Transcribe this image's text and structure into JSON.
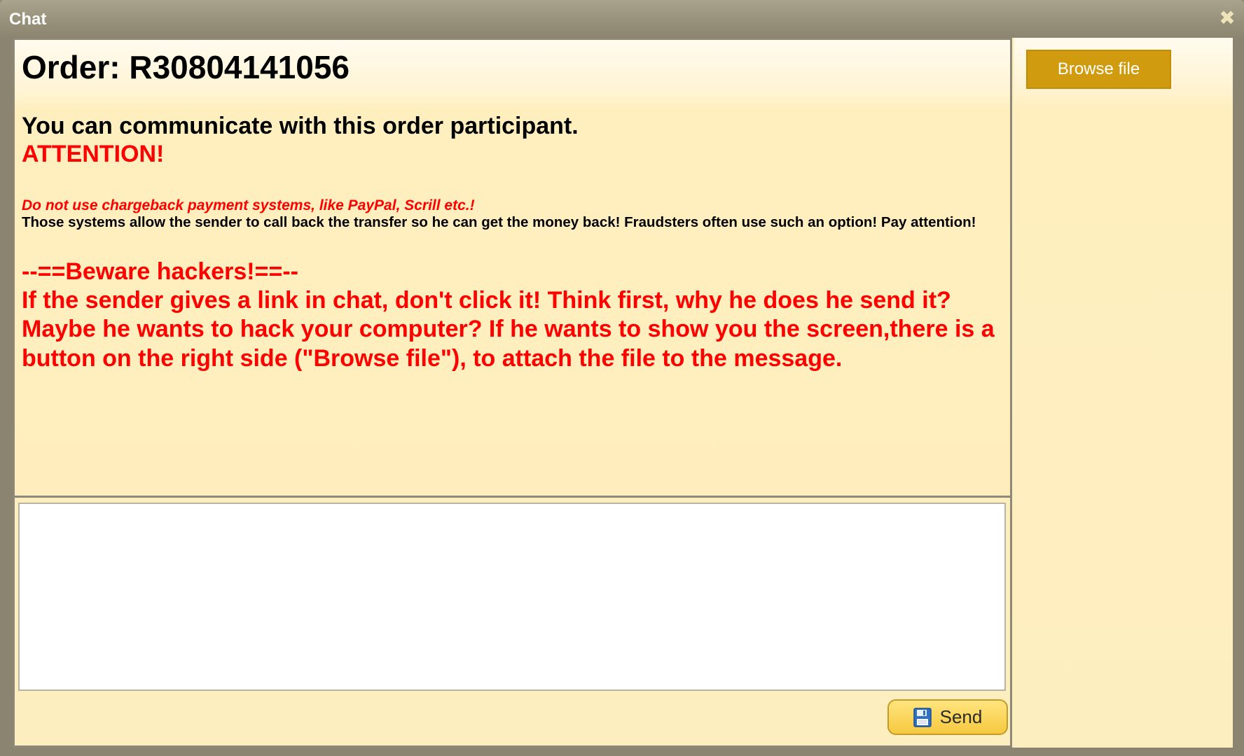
{
  "window": {
    "title": "Chat",
    "close_icon": "close-icon"
  },
  "messages": {
    "order_title": "Order: R30804141056",
    "intro": "You can communicate with this order participant.",
    "attention": "ATTENTION!",
    "chargeback_warning": "Do not use chargeback payment systems, like PayPal, Scrill etc.!",
    "chargeback_explanation": "Those systems allow the sender to call back the transfer so he can get the money back! Fraudsters often use such an option! Pay attention!",
    "beware_heading": "--==Beware hackers!==--",
    "hacker_warning": "If the sender gives a link in chat, don't click it! Think first, why he does he send it? Maybe he wants to hack your computer? If he wants to show you the screen,there is a button on the right side (\"Browse file\"), to attach the file to the message."
  },
  "compose": {
    "input_value": "",
    "send_label": "Send",
    "send_icon": "floppy-disk-icon"
  },
  "sidebar": {
    "browse_label": "Browse file"
  },
  "colors": {
    "warning_red": "#ff0000",
    "background_cream": "#ffedbd",
    "browse_gold": "#d19b10",
    "titlebar_gray": "#968f79"
  }
}
